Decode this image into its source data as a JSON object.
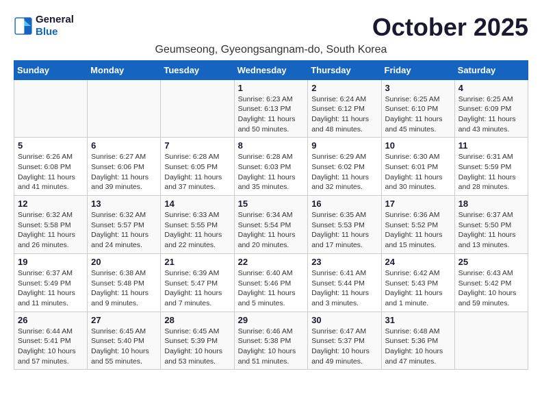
{
  "logo": {
    "line1": "General",
    "line2": "Blue"
  },
  "title": "October 2025",
  "subtitle": "Geumseong, Gyeongsangnam-do, South Korea",
  "days_of_week": [
    "Sunday",
    "Monday",
    "Tuesday",
    "Wednesday",
    "Thursday",
    "Friday",
    "Saturday"
  ],
  "weeks": [
    [
      {
        "day": "",
        "info": ""
      },
      {
        "day": "",
        "info": ""
      },
      {
        "day": "",
        "info": ""
      },
      {
        "day": "1",
        "info": "Sunrise: 6:23 AM\nSunset: 6:13 PM\nDaylight: 11 hours\nand 50 minutes."
      },
      {
        "day": "2",
        "info": "Sunrise: 6:24 AM\nSunset: 6:12 PM\nDaylight: 11 hours\nand 48 minutes."
      },
      {
        "day": "3",
        "info": "Sunrise: 6:25 AM\nSunset: 6:10 PM\nDaylight: 11 hours\nand 45 minutes."
      },
      {
        "day": "4",
        "info": "Sunrise: 6:25 AM\nSunset: 6:09 PM\nDaylight: 11 hours\nand 43 minutes."
      }
    ],
    [
      {
        "day": "5",
        "info": "Sunrise: 6:26 AM\nSunset: 6:08 PM\nDaylight: 11 hours\nand 41 minutes."
      },
      {
        "day": "6",
        "info": "Sunrise: 6:27 AM\nSunset: 6:06 PM\nDaylight: 11 hours\nand 39 minutes."
      },
      {
        "day": "7",
        "info": "Sunrise: 6:28 AM\nSunset: 6:05 PM\nDaylight: 11 hours\nand 37 minutes."
      },
      {
        "day": "8",
        "info": "Sunrise: 6:28 AM\nSunset: 6:03 PM\nDaylight: 11 hours\nand 35 minutes."
      },
      {
        "day": "9",
        "info": "Sunrise: 6:29 AM\nSunset: 6:02 PM\nDaylight: 11 hours\nand 32 minutes."
      },
      {
        "day": "10",
        "info": "Sunrise: 6:30 AM\nSunset: 6:01 PM\nDaylight: 11 hours\nand 30 minutes."
      },
      {
        "day": "11",
        "info": "Sunrise: 6:31 AM\nSunset: 5:59 PM\nDaylight: 11 hours\nand 28 minutes."
      }
    ],
    [
      {
        "day": "12",
        "info": "Sunrise: 6:32 AM\nSunset: 5:58 PM\nDaylight: 11 hours\nand 26 minutes."
      },
      {
        "day": "13",
        "info": "Sunrise: 6:32 AM\nSunset: 5:57 PM\nDaylight: 11 hours\nand 24 minutes."
      },
      {
        "day": "14",
        "info": "Sunrise: 6:33 AM\nSunset: 5:55 PM\nDaylight: 11 hours\nand 22 minutes."
      },
      {
        "day": "15",
        "info": "Sunrise: 6:34 AM\nSunset: 5:54 PM\nDaylight: 11 hours\nand 20 minutes."
      },
      {
        "day": "16",
        "info": "Sunrise: 6:35 AM\nSunset: 5:53 PM\nDaylight: 11 hours\nand 17 minutes."
      },
      {
        "day": "17",
        "info": "Sunrise: 6:36 AM\nSunset: 5:52 PM\nDaylight: 11 hours\nand 15 minutes."
      },
      {
        "day": "18",
        "info": "Sunrise: 6:37 AM\nSunset: 5:50 PM\nDaylight: 11 hours\nand 13 minutes."
      }
    ],
    [
      {
        "day": "19",
        "info": "Sunrise: 6:37 AM\nSunset: 5:49 PM\nDaylight: 11 hours\nand 11 minutes."
      },
      {
        "day": "20",
        "info": "Sunrise: 6:38 AM\nSunset: 5:48 PM\nDaylight: 11 hours\nand 9 minutes."
      },
      {
        "day": "21",
        "info": "Sunrise: 6:39 AM\nSunset: 5:47 PM\nDaylight: 11 hours\nand 7 minutes."
      },
      {
        "day": "22",
        "info": "Sunrise: 6:40 AM\nSunset: 5:46 PM\nDaylight: 11 hours\nand 5 minutes."
      },
      {
        "day": "23",
        "info": "Sunrise: 6:41 AM\nSunset: 5:44 PM\nDaylight: 11 hours\nand 3 minutes."
      },
      {
        "day": "24",
        "info": "Sunrise: 6:42 AM\nSunset: 5:43 PM\nDaylight: 11 hours\nand 1 minute."
      },
      {
        "day": "25",
        "info": "Sunrise: 6:43 AM\nSunset: 5:42 PM\nDaylight: 10 hours\nand 59 minutes."
      }
    ],
    [
      {
        "day": "26",
        "info": "Sunrise: 6:44 AM\nSunset: 5:41 PM\nDaylight: 10 hours\nand 57 minutes."
      },
      {
        "day": "27",
        "info": "Sunrise: 6:45 AM\nSunset: 5:40 PM\nDaylight: 10 hours\nand 55 minutes."
      },
      {
        "day": "28",
        "info": "Sunrise: 6:45 AM\nSunset: 5:39 PM\nDaylight: 10 hours\nand 53 minutes."
      },
      {
        "day": "29",
        "info": "Sunrise: 6:46 AM\nSunset: 5:38 PM\nDaylight: 10 hours\nand 51 minutes."
      },
      {
        "day": "30",
        "info": "Sunrise: 6:47 AM\nSunset: 5:37 PM\nDaylight: 10 hours\nand 49 minutes."
      },
      {
        "day": "31",
        "info": "Sunrise: 6:48 AM\nSunset: 5:36 PM\nDaylight: 10 hours\nand 47 minutes."
      },
      {
        "day": "",
        "info": ""
      }
    ]
  ]
}
